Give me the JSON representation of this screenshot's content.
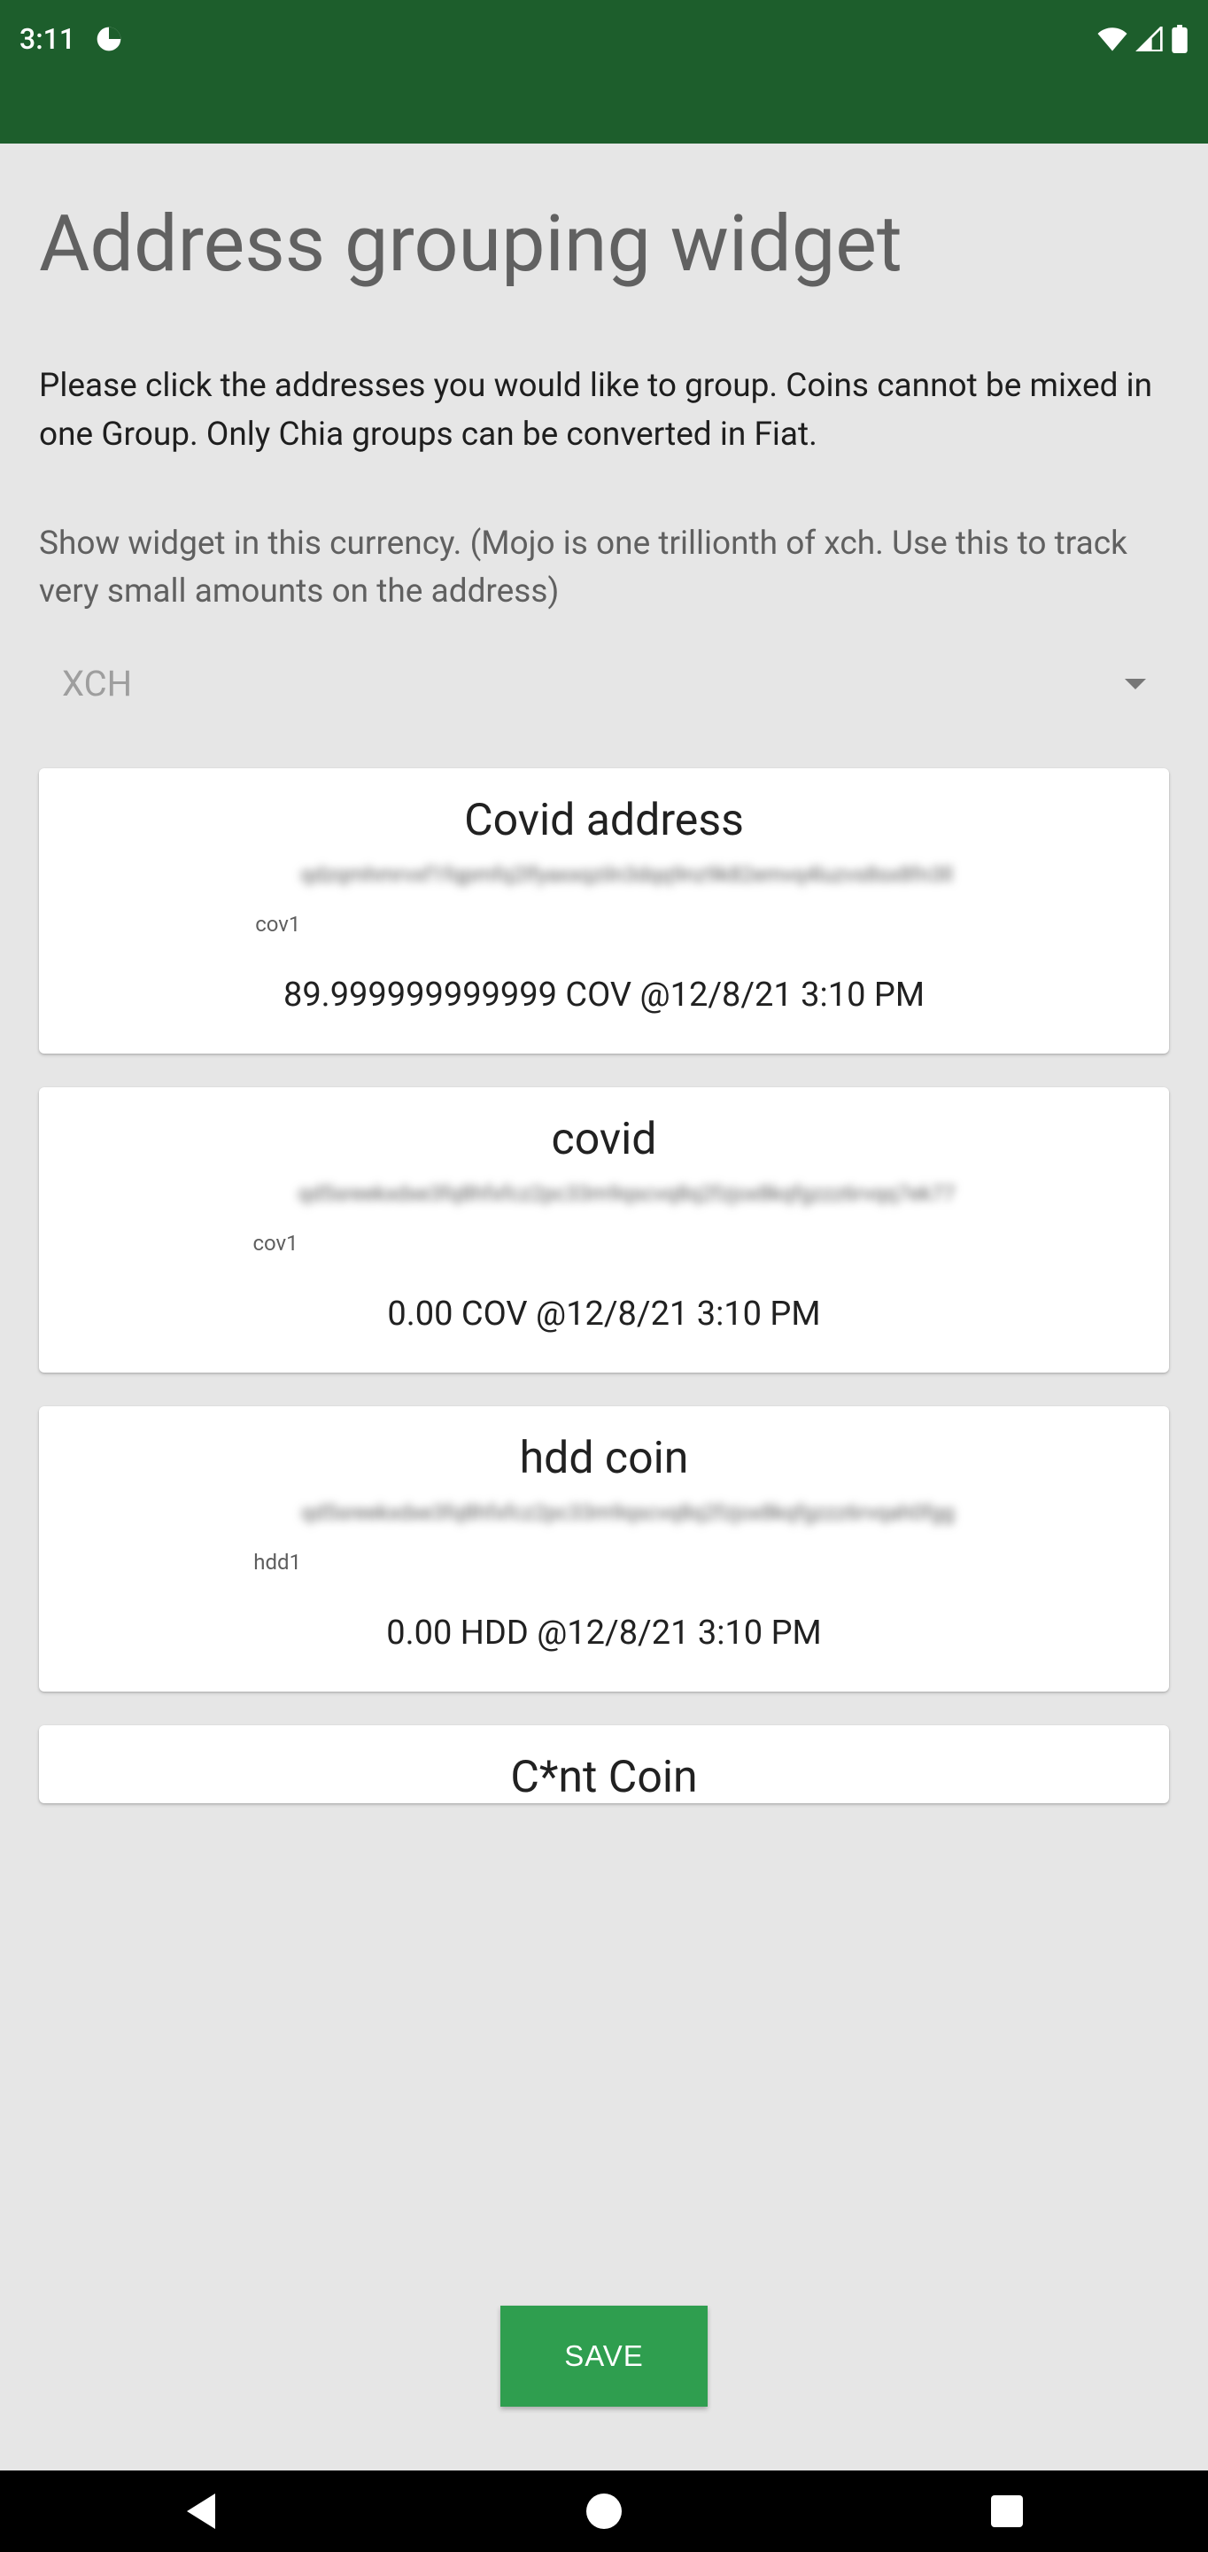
{
  "status": {
    "time": "3:11"
  },
  "page": {
    "title": "Address grouping widget",
    "desc1": "Please click the addresses you would like to group. Coins cannot be mixed in one Group. Only Chia groups can be converted in Fiat.",
    "desc2": "Show widget in this currency. (Mojo is one trillionth of xch. Use this to track very small amounts on the address)"
  },
  "currency": {
    "selected": "XCH"
  },
  "cards": [
    {
      "title": "Covid address",
      "prefix": "cov1",
      "addr": "qdzqmhmrvxf1fqpmfq2lfyaxxqziln3dqq9nz9k82emvq4luzvs8sx8fn3ll",
      "balance": "89.999999999999 COV @12/8/21 3:10 PM"
    },
    {
      "title": "covid",
      "prefix": "cov1",
      "addr": "qd5sreekxdxe3fq8hfxfcz2pc33m9qscvq8q2fzjox8kqfgzzz6rvqq7ek77",
      "balance": "0.00 COV @12/8/21 3:10 PM"
    },
    {
      "title": "hdd coin",
      "prefix": "hdd1",
      "addr": "qd5sreekxdxe3fq8hfxfcz2pc33m9qscvq8q2fzjox8kqfgzzz6rvqah0fgg",
      "balance": "0.00 HDD @12/8/21 3:10 PM"
    },
    {
      "title": "C*nt Coin",
      "prefix": "",
      "addr": "",
      "balance": ""
    }
  ],
  "buttons": {
    "save": "SAVE"
  }
}
